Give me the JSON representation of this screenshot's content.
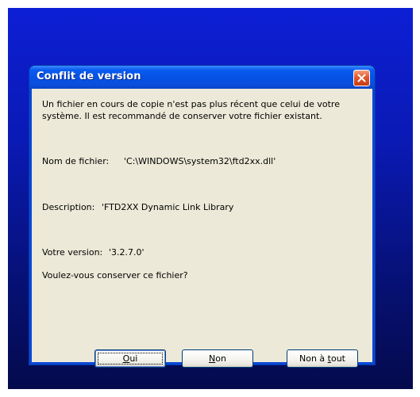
{
  "window": {
    "title": "Conflit de version"
  },
  "message": {
    "line1": "Un fichier en cours de copie n'est pas plus récent que celui de votre",
    "line2": "système. Il est recommandé de conserver votre fichier existant."
  },
  "file": {
    "name_label": "Nom de fichier:",
    "name_value": "'C:\\WINDOWS\\system32\\ftd2xx.dll'",
    "description_label": "Description:",
    "description_value": "'FTD2XX Dynamic Link Library",
    "version_label": "Votre version:",
    "version_value": "'3.2.7.0'"
  },
  "question": "Voulez-vous conserver ce fichier?",
  "buttons": {
    "yes": {
      "accel": "O",
      "rest": "ui"
    },
    "no": {
      "accel": "N",
      "rest": "on"
    },
    "no_to_all": {
      "prefix": "Non à ",
      "accel": "t",
      "rest": "out"
    }
  },
  "colors": {
    "titlebar": "#0552e6",
    "client": "#ece9d8",
    "close": "#e1582e",
    "desktop": "#0a1ab4"
  }
}
